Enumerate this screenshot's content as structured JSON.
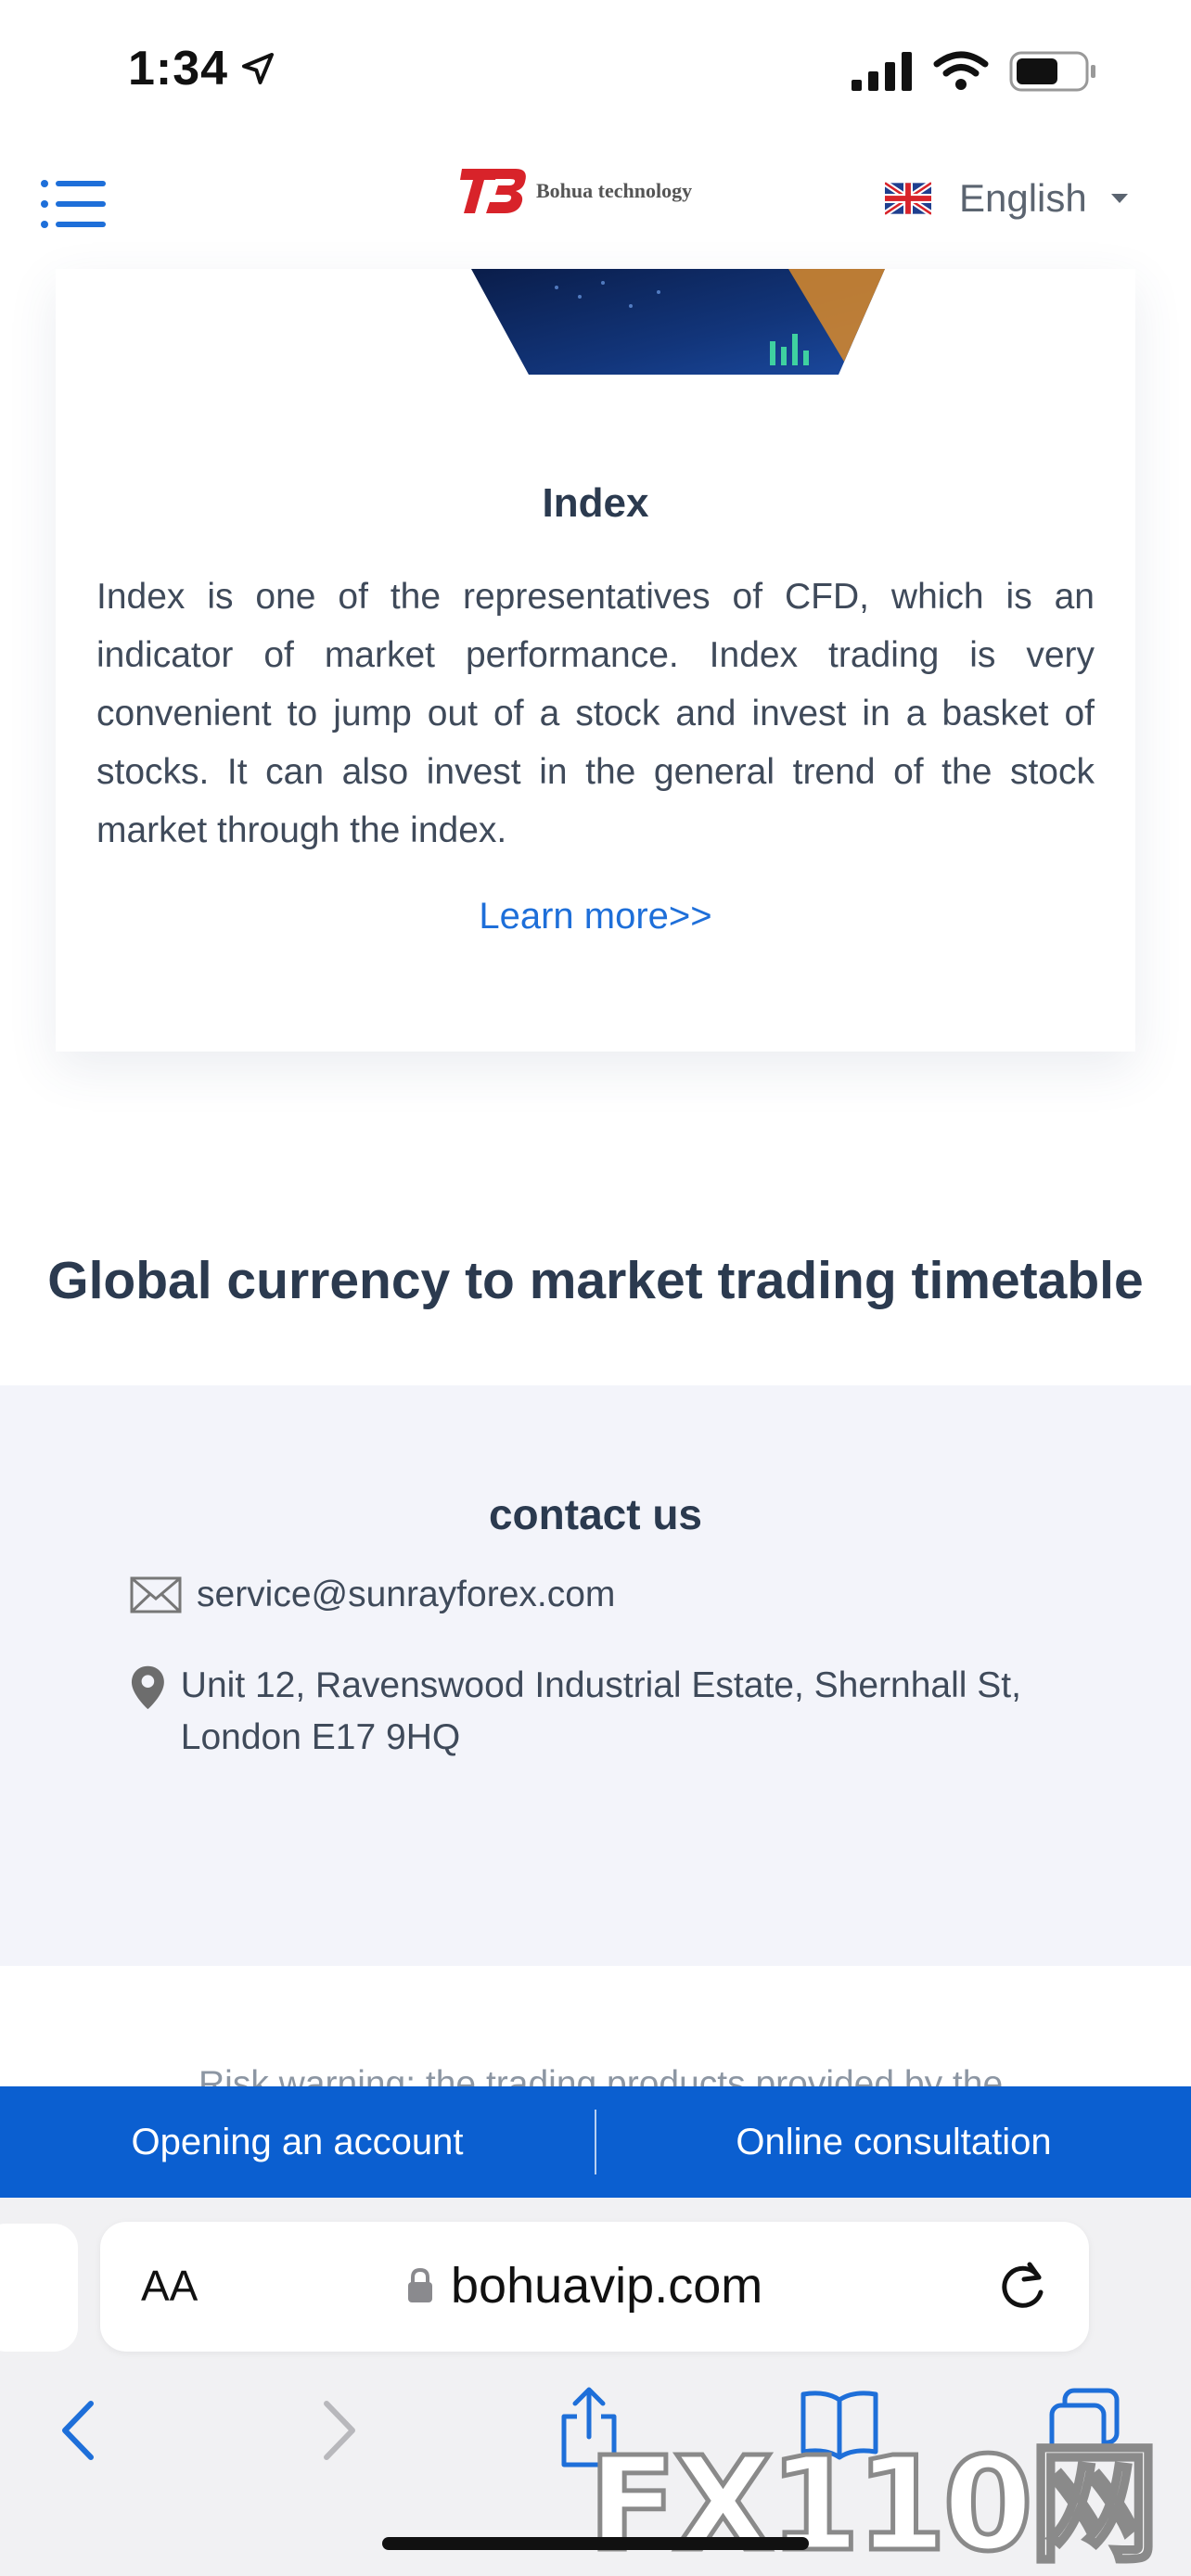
{
  "status_bar": {
    "time": "1:34"
  },
  "header": {
    "logo_text": "Bohua technology",
    "language": "English"
  },
  "card": {
    "title": "Index",
    "description": "Index is one of the representatives of CFD, which is an indicator of market performance. Index trading is very convenient to jump out of a stock and invest in a basket of stocks. It can also invest in the general trend of the stock market through the index.",
    "learn_more": "Learn more>>"
  },
  "timetable": {
    "title": "Global currency to market trading timetable"
  },
  "contact": {
    "title": "contact us",
    "email": "service@sunrayforex.com",
    "address": "Unit 12, Ravenswood Industrial Estate, Shernhall St, London E17 9HQ"
  },
  "risk": {
    "partial_text": "Risk warning: the trading products provided by the"
  },
  "cta": {
    "open_account": "Opening an account",
    "consultation": "Online consultation"
  },
  "browser": {
    "aa_label": "AA",
    "url": "bohuavip.com"
  },
  "watermark": "FX110网",
  "colors": {
    "accent": "#0b5fd0",
    "link": "#1e6fd9",
    "heading": "#2b3a4f",
    "contact_bg": "#f3f4fa"
  }
}
